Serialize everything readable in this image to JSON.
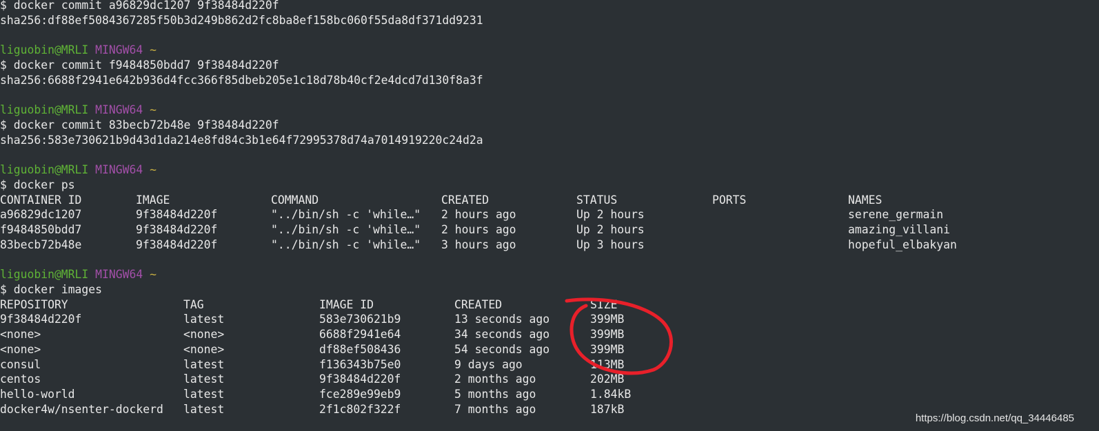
{
  "prompt": {
    "user_host": "liguobin@MRLI",
    "system": "MINGW64",
    "path": "~",
    "symbol": "$"
  },
  "blocks": [
    {
      "command": "docker commit a96829dc1207 9f38484d220f",
      "output": "sha256:df88ef5084367285f50b3d249b862d2fc8ba8ef158bc060f55da8df371dd9231"
    },
    {
      "command": "docker commit f9484850bdd7 9f38484d220f",
      "output": "sha256:6688f2941e642b936d4fcc366f85dbeb205e1c18d78b40cf2e4dcd7d130f8a3f"
    },
    {
      "command": "docker commit 83becb72b48e 9f38484d220f",
      "output": "sha256:583e730621b9d43d1da214e8fd84c3b1e64f72995378d74a7014919220c24d2a"
    }
  ],
  "ps": {
    "command": "docker ps",
    "headers": [
      "CONTAINER ID",
      "IMAGE",
      "COMMAND",
      "CREATED",
      "STATUS",
      "PORTS",
      "NAMES"
    ],
    "rows": [
      [
        "a96829dc1207",
        "9f38484d220f",
        "\"../bin/sh -c 'while…\"",
        "2 hours ago",
        "Up 2 hours",
        "",
        "serene_germain"
      ],
      [
        "f9484850bdd7",
        "9f38484d220f",
        "\"../bin/sh -c 'while…\"",
        "2 hours ago",
        "Up 2 hours",
        "",
        "amazing_villani"
      ],
      [
        "83becb72b48e",
        "9f38484d220f",
        "\"../bin/sh -c 'while…\"",
        "3 hours ago",
        "Up 3 hours",
        "",
        "hopeful_elbakyan"
      ]
    ]
  },
  "images": {
    "command": "docker images",
    "headers": [
      "REPOSITORY",
      "TAG",
      "IMAGE ID",
      "CREATED",
      "SIZE"
    ],
    "rows": [
      [
        "9f38484d220f",
        "latest",
        "583e730621b9",
        "13 seconds ago",
        "399MB"
      ],
      [
        "<none>",
        "<none>",
        "6688f2941e64",
        "34 seconds ago",
        "399MB"
      ],
      [
        "<none>",
        "<none>",
        "df88ef508436",
        "54 seconds ago",
        "399MB"
      ],
      [
        "consul",
        "latest",
        "f136343b75e0",
        "9 days ago",
        "113MB"
      ],
      [
        "centos",
        "latest",
        "9f38484d220f",
        "2 months ago",
        "202MB"
      ],
      [
        "hello-world",
        "latest",
        "fce289e99eb9",
        "5 months ago",
        "1.84kB"
      ],
      [
        "docker4w/nsenter-dockerd",
        "latest",
        "2f1c802f322f",
        "7 months ago",
        "187kB"
      ]
    ]
  },
  "annotation_color": "#e8202a",
  "watermark": "https://blog.csdn.net/qq_34446485"
}
